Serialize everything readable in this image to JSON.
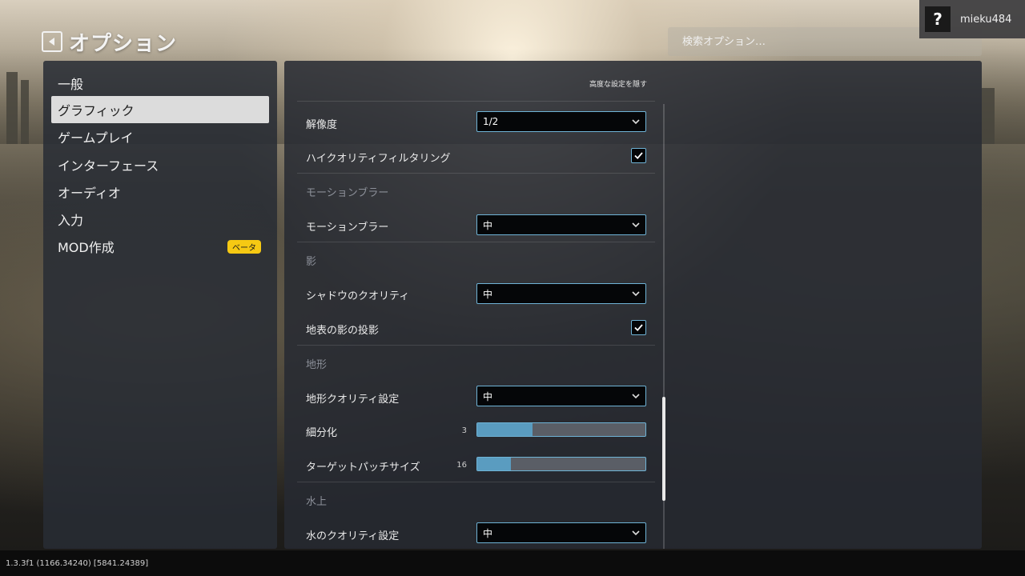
{
  "header": {
    "title": "オプション",
    "search_placeholder": "検索オプション…"
  },
  "user": {
    "help_label": "?",
    "username": "mieku484"
  },
  "sidebar": {
    "items": [
      {
        "label": "一般"
      },
      {
        "label": "グラフィック",
        "active": true
      },
      {
        "label": "ゲームプレイ"
      },
      {
        "label": "インターフェース"
      },
      {
        "label": "オーディオ"
      },
      {
        "label": "入力"
      },
      {
        "label": "MOD作成",
        "badge": "ベータ"
      }
    ]
  },
  "main": {
    "hide_advanced_label": "高度な設定を隠す",
    "rows": {
      "resolution": {
        "label": "解像度",
        "value": "1/2"
      },
      "high_quality_filtering": {
        "label": "ハイクオリティフィルタリング",
        "checked": true
      },
      "motion_blur_section": "モーションブラー",
      "motion_blur": {
        "label": "モーションブラー",
        "value": "中"
      },
      "shadow_section": "影",
      "shadow_quality": {
        "label": "シャドウのクオリティ",
        "value": "中"
      },
      "terrain_shadow_casting": {
        "label": "地表の影の投影",
        "checked": true
      },
      "terrain_section": "地形",
      "terrain_quality": {
        "label": "地形クオリティ設定",
        "value": "中"
      },
      "tessellation": {
        "label": "細分化",
        "value": "3",
        "fill": 0.33
      },
      "target_patch_size": {
        "label": "ターゲットパッチサイズ",
        "value": "16",
        "fill": 0.2
      },
      "water_section": "水上",
      "water_quality": {
        "label": "水のクオリティ設定",
        "value": "中"
      }
    }
  },
  "status_bar": {
    "version": "1.3.3f1 (1166.34240) [5841.24389]"
  }
}
